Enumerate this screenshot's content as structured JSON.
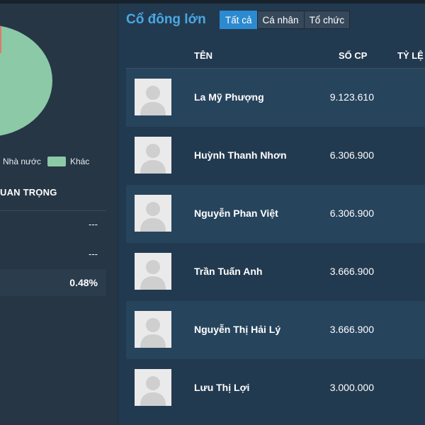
{
  "left_panel": {
    "legend": {
      "item1": "Nhà nước",
      "item2": "Khác",
      "swatch_color": "#8cc9a7"
    },
    "section_title": "UAN TRỌNG",
    "rows": [
      "---",
      "---",
      "0.48%"
    ]
  },
  "shareholders": {
    "title": "Cổ đông lớn",
    "tabs": [
      {
        "label": "Tất cả",
        "active": true
      },
      {
        "label": "Cá nhân",
        "active": false
      },
      {
        "label": "Tổ chức",
        "active": false
      }
    ],
    "columns": {
      "name": "TÊN",
      "shares": "SỐ CP",
      "ratio": "TỶ LỆ"
    },
    "rows": [
      {
        "name": "La Mỹ Phượng",
        "shares": "9.123.610"
      },
      {
        "name": "Huỳnh Thanh Nhơn",
        "shares": "6.306.900"
      },
      {
        "name": "Nguyễn Phan Việt",
        "shares": "6.306.900"
      },
      {
        "name": "Trần Tuấn Anh",
        "shares": "3.666.900"
      },
      {
        "name": "Nguyễn Thị Hải Lý",
        "shares": "3.666.900"
      },
      {
        "name": "Lưu Thị Lợi",
        "shares": "3.000.000"
      }
    ]
  }
}
